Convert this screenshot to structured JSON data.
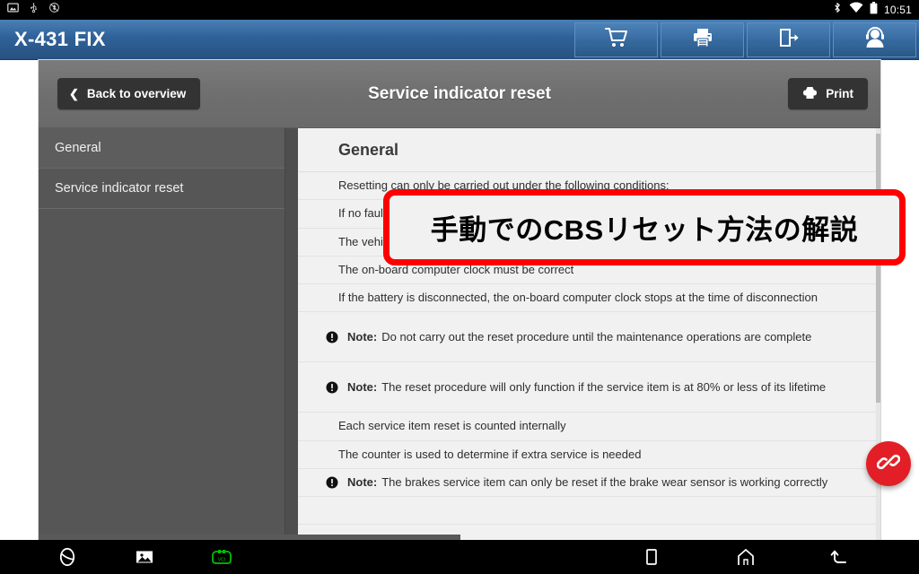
{
  "statusbar": {
    "icons_left": [
      "screenshot-icon",
      "usb-icon",
      "bluetooth-disabled-icon"
    ],
    "icons_right": [
      "bluetooth-icon",
      "wifi-icon",
      "battery-icon"
    ],
    "clock": "10:51"
  },
  "appbar": {
    "title": "X-431 FIX",
    "buttons": [
      {
        "name": "cart-button",
        "icon": "shopping-cart-icon"
      },
      {
        "name": "print-button",
        "icon": "printer-icon"
      },
      {
        "name": "exit-button",
        "icon": "exit-icon"
      },
      {
        "name": "support-button",
        "icon": "headset-user-icon"
      }
    ]
  },
  "diagnostic": {
    "back_label": "Back to overview",
    "title": "Service indicator reset",
    "print_label": "Print",
    "nav_items": [
      {
        "label": "General",
        "selected": true
      },
      {
        "label": "Service indicator reset",
        "selected": false
      }
    ],
    "content_heading": "General",
    "rows": [
      {
        "text": "Resetting can only be carried out under the following conditions:",
        "note": false,
        "tall": false
      },
      {
        "text": "If no fault codes are present, proceed as follows:",
        "note": false,
        "tall": false
      },
      {
        "text": "The vehicle is equipped with 'Condition Based Servicing'",
        "note": false,
        "tall": false
      },
      {
        "text": "The on-board computer clock must be correct",
        "note": false,
        "tall": false
      },
      {
        "text": "If the battery is disconnected, the on-board computer clock stops at the time of disconnection",
        "note": false,
        "tall": false
      },
      {
        "text": "Do not carry out the reset procedure until the maintenance operations are complete",
        "note": true,
        "note_label": "Note:",
        "tall": true
      },
      {
        "text": "The reset procedure will only function if the service item is at 80% or less of its lifetime",
        "note": true,
        "note_label": "Note:",
        "tall": true
      },
      {
        "text": "Each service item reset is counted internally",
        "note": false,
        "tall": false
      },
      {
        "text": "The counter is used to determine if extra service is needed",
        "note": false,
        "tall": false
      },
      {
        "text": "Note: The brakes service item can only be reset if the brake wear sensor is working correctly",
        "note": true,
        "note_label": "Note:",
        "note_text": "The brakes service item can only be reset if the brake wear sensor is working correctly",
        "tall": false
      }
    ]
  },
  "annotation": {
    "text": "手動でのCBSリセット方法の解説",
    "border_color": "#ff0000"
  },
  "fab": {
    "icon": "link-chain-icon",
    "color": "#e21f26"
  },
  "navbar": {
    "left": [
      {
        "name": "browser-icon"
      },
      {
        "name": "gallery-icon"
      },
      {
        "name": "vci-connector-icon",
        "label": "VCI",
        "color": "#00c000"
      }
    ],
    "right": [
      {
        "name": "recents-square-icon"
      },
      {
        "name": "home-icon"
      },
      {
        "name": "back-icon"
      }
    ]
  },
  "colors": {
    "appbar_blue": "#2f6199",
    "header_gray": "#6e6e6e",
    "nav_gray": "#565656",
    "content_bg": "#f1f1f1",
    "accent_red": "#e21f26"
  }
}
